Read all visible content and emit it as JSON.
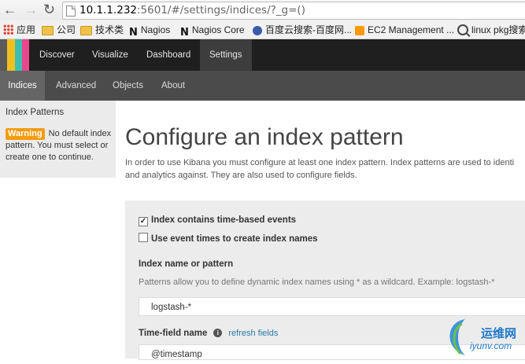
{
  "browser": {
    "url_host": "10.1.1.232",
    "url_rest": ":5601/#/settings/indices/?_g=()",
    "bookmarks": [
      {
        "label": "应用",
        "icon": "apps-icon"
      },
      {
        "label": "公司",
        "icon": "folder-icon"
      },
      {
        "label": "技术类",
        "icon": "folder-icon"
      },
      {
        "label": "Nagios",
        "icon": "nagios-icon"
      },
      {
        "label": "Nagios Core",
        "icon": "nagios-icon"
      },
      {
        "label": "百度云搜索-百度网...",
        "icon": "baidu-icon"
      },
      {
        "label": "EC2 Management ...",
        "icon": "aws-icon"
      },
      {
        "label": "linux pkg搜索",
        "icon": "search-icon"
      }
    ]
  },
  "logo_colors": [
    "#e8488b",
    "#3cbeb1",
    "#f2c01e",
    "#5a5a5a"
  ],
  "top_nav": [
    "Discover",
    "Visualize",
    "Dashboard",
    "Settings"
  ],
  "sub_nav": [
    "Indices",
    "Advanced",
    "Objects",
    "About"
  ],
  "sidebar": {
    "title": "Index Patterns",
    "warning_badge": "Warning",
    "warning_text": "No default index pattern. You must select or create one to continue."
  },
  "main": {
    "title": "Configure an index pattern",
    "intro_line1": "In order to use Kibana you must configure at least one index pattern. Index patterns are used to identi",
    "intro_line2": "and analytics against. They are also used to configure fields.",
    "checkbox_time_based": {
      "label": "Index contains time-based events",
      "checked": true
    },
    "checkbox_event_times": {
      "label": "Use event times to create index names",
      "checked": false
    },
    "index_label": "Index name or pattern",
    "index_help": "Patterns allow you to define dynamic index names using * as a wildcard. Example: logstash-*",
    "index_value": "logstash-*",
    "time_field_label": "Time-field name",
    "refresh_link": "refresh fields",
    "time_field_value": "@timestamp"
  },
  "watermark": {
    "site": "运维网",
    "url": "iyunv.com"
  },
  "colors": {
    "accent": "#f39c12",
    "link": "#2a7aa8",
    "nav_bg": "#1f1f1f",
    "subnav_bg": "#4b4b4b"
  }
}
